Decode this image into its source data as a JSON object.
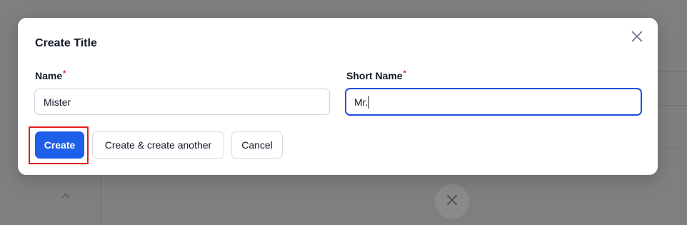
{
  "modal": {
    "title": "Create Title",
    "close_icon": "close-icon"
  },
  "form": {
    "name": {
      "label": "Name",
      "required_mark": "*",
      "value": "Mister"
    },
    "short_name": {
      "label": "Short Name",
      "required_mark": "*",
      "value": "Mr."
    }
  },
  "actions": {
    "create_label": "Create",
    "create_another_label": "Create & create another",
    "cancel_label": "Cancel"
  },
  "colors": {
    "primary": "#1d5fe9",
    "focus_border": "#1d4ed8",
    "required": "#dc2626",
    "highlight": "#e11d1d",
    "overlay": "#7f7f7f"
  },
  "background": {
    "chevron_icon": "chevron-up-icon",
    "close_icon": "close-icon"
  }
}
